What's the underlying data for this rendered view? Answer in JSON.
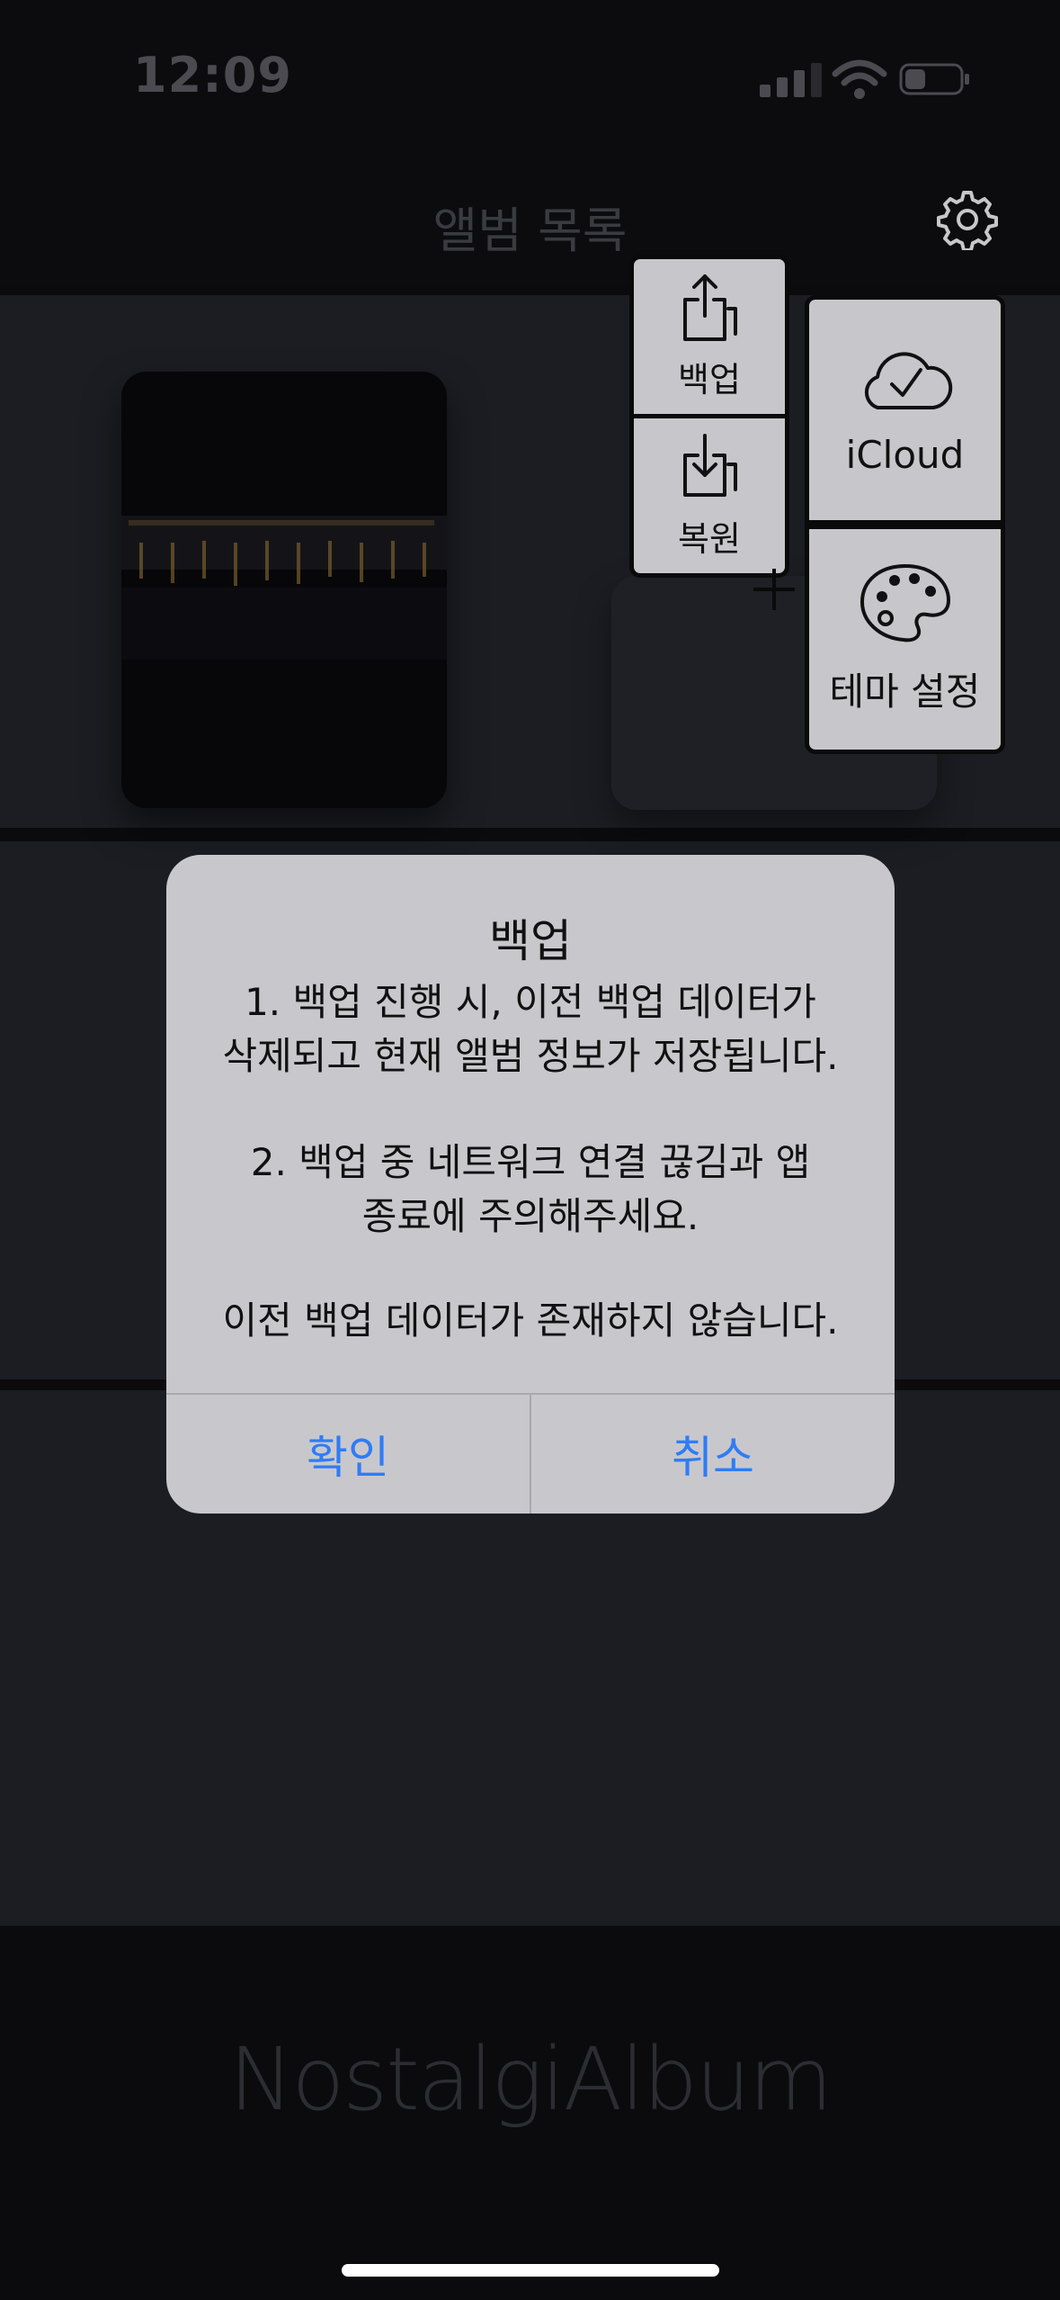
{
  "status_bar": {
    "time": "12:09"
  },
  "header": {
    "title": "앨범 목록"
  },
  "menu": {
    "backup_label": "백업",
    "restore_label": "복원",
    "icloud_label": "iCloud",
    "theme_label": "테마 설정"
  },
  "footer": {
    "app_name": "NostalgiAlbum"
  },
  "alert": {
    "title": "백업",
    "lines": [
      "1. 백업 진행 시, 이전 백업 데이터가",
      "삭제되고 현재 앨범 정보가 저장됩니다.",
      "2. 백업 중 네트워크 연결 끊김과 앱",
      "종료에 주의해주세요.",
      "이전 백업 데이터가 존재하지 않습니다."
    ],
    "confirm_label": "확인",
    "cancel_label": "취소"
  },
  "colors": {
    "alert_button_text": "#2f7cf6",
    "menu_bg": "#c7c7cb",
    "alert_bg": "#c8c8cc"
  }
}
